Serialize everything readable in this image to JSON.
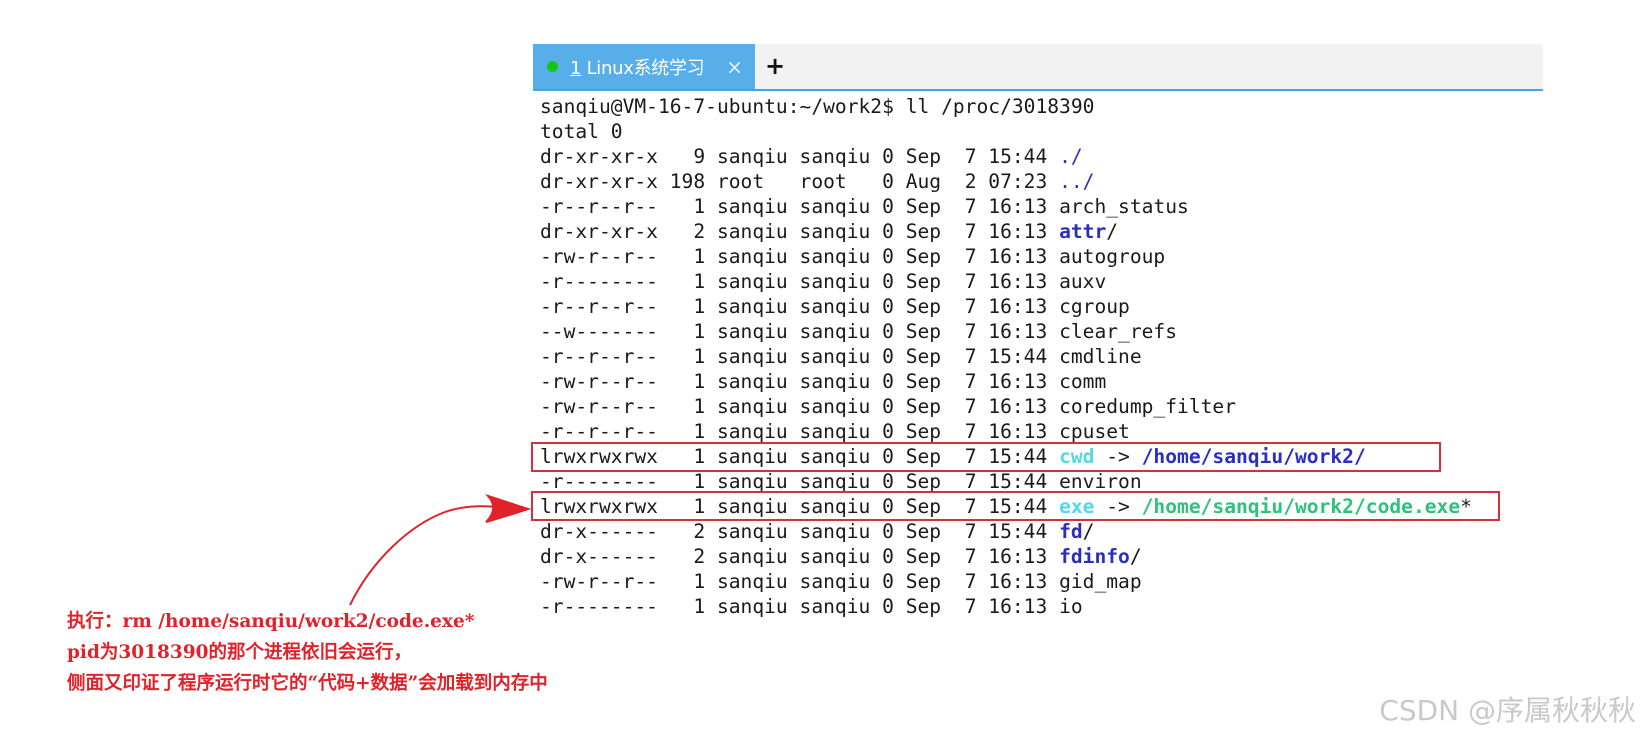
{
  "tab": {
    "number": "1",
    "title": "Linux系统学习",
    "close_icon": "×",
    "new_tab_icon": "+"
  },
  "terminal": {
    "prompt": "sanqiu@VM-16-7-ubuntu:~/work2$",
    "command": "ll /proc/3018390",
    "total": "total 0",
    "rows": [
      {
        "perm": "dr-xr-xr-x",
        "links": "9",
        "owner": "sanqiu",
        "group": "sanqiu",
        "size": "0",
        "mon": "Sep",
        "day": "7",
        "time": "15:44",
        "name": ".",
        "suffix": "/",
        "kind": "dir"
      },
      {
        "perm": "dr-xr-xr-x",
        "links": "198",
        "owner": "root",
        "group": "root",
        "size": "0",
        "mon": "Aug",
        "day": "2",
        "time": "07:23",
        "name": "..",
        "suffix": "/",
        "kind": "dir"
      },
      {
        "perm": "-r--r--r--",
        "links": "1",
        "owner": "sanqiu",
        "group": "sanqiu",
        "size": "0",
        "mon": "Sep",
        "day": "7",
        "time": "16:13",
        "name": "arch_status",
        "suffix": "",
        "kind": "file"
      },
      {
        "perm": "dr-xr-xr-x",
        "links": "2",
        "owner": "sanqiu",
        "group": "sanqiu",
        "size": "0",
        "mon": "Sep",
        "day": "7",
        "time": "16:13",
        "name": "attr",
        "suffix": "/",
        "kind": "dir-b"
      },
      {
        "perm": "-rw-r--r--",
        "links": "1",
        "owner": "sanqiu",
        "group": "sanqiu",
        "size": "0",
        "mon": "Sep",
        "day": "7",
        "time": "16:13",
        "name": "autogroup",
        "suffix": "",
        "kind": "file"
      },
      {
        "perm": "-r--------",
        "links": "1",
        "owner": "sanqiu",
        "group": "sanqiu",
        "size": "0",
        "mon": "Sep",
        "day": "7",
        "time": "16:13",
        "name": "auxv",
        "suffix": "",
        "kind": "file"
      },
      {
        "perm": "-r--r--r--",
        "links": "1",
        "owner": "sanqiu",
        "group": "sanqiu",
        "size": "0",
        "mon": "Sep",
        "day": "7",
        "time": "16:13",
        "name": "cgroup",
        "suffix": "",
        "kind": "file"
      },
      {
        "perm": "--w-------",
        "links": "1",
        "owner": "sanqiu",
        "group": "sanqiu",
        "size": "0",
        "mon": "Sep",
        "day": "7",
        "time": "16:13",
        "name": "clear_refs",
        "suffix": "",
        "kind": "file"
      },
      {
        "perm": "-r--r--r--",
        "links": "1",
        "owner": "sanqiu",
        "group": "sanqiu",
        "size": "0",
        "mon": "Sep",
        "day": "7",
        "time": "15:44",
        "name": "cmdline",
        "suffix": "",
        "kind": "file"
      },
      {
        "perm": "-rw-r--r--",
        "links": "1",
        "owner": "sanqiu",
        "group": "sanqiu",
        "size": "0",
        "mon": "Sep",
        "day": "7",
        "time": "16:13",
        "name": "comm",
        "suffix": "",
        "kind": "file"
      },
      {
        "perm": "-rw-r--r--",
        "links": "1",
        "owner": "sanqiu",
        "group": "sanqiu",
        "size": "0",
        "mon": "Sep",
        "day": "7",
        "time": "16:13",
        "name": "coredump_filter",
        "suffix": "",
        "kind": "file"
      },
      {
        "perm": "-r--r--r--",
        "links": "1",
        "owner": "sanqiu",
        "group": "sanqiu",
        "size": "0",
        "mon": "Sep",
        "day": "7",
        "time": "16:13",
        "name": "cpuset",
        "suffix": "",
        "kind": "file"
      },
      {
        "perm": "lrwxrwxrwx",
        "links": "1",
        "owner": "sanqiu",
        "group": "sanqiu",
        "size": "0",
        "mon": "Sep",
        "day": "7",
        "time": "15:44",
        "name": "cwd",
        "arrow": " -> ",
        "target": "/home/sanqiu/work2/",
        "suffix": "",
        "kind": "link-dir"
      },
      {
        "perm": "-r--------",
        "links": "1",
        "owner": "sanqiu",
        "group": "sanqiu",
        "size": "0",
        "mon": "Sep",
        "day": "7",
        "time": "15:44",
        "name": "environ",
        "suffix": "",
        "kind": "file"
      },
      {
        "perm": "lrwxrwxrwx",
        "links": "1",
        "owner": "sanqiu",
        "group": "sanqiu",
        "size": "0",
        "mon": "Sep",
        "day": "7",
        "time": "15:44",
        "name": "exe",
        "arrow": " -> ",
        "target": "/home/sanqiu/work2/code.exe",
        "suffix": "*",
        "kind": "link-exe"
      },
      {
        "perm": "dr-x------",
        "links": "2",
        "owner": "sanqiu",
        "group": "sanqiu",
        "size": "0",
        "mon": "Sep",
        "day": "7",
        "time": "15:44",
        "name": "fd",
        "suffix": "/",
        "kind": "dir-b"
      },
      {
        "perm": "dr-x------",
        "links": "2",
        "owner": "sanqiu",
        "group": "sanqiu",
        "size": "0",
        "mon": "Sep",
        "day": "7",
        "time": "16:13",
        "name": "fdinfo",
        "suffix": "/",
        "kind": "dir-b"
      },
      {
        "perm": "-rw-r--r--",
        "links": "1",
        "owner": "sanqiu",
        "group": "sanqiu",
        "size": "0",
        "mon": "Sep",
        "day": "7",
        "time": "16:13",
        "name": "gid_map",
        "suffix": "",
        "kind": "file"
      },
      {
        "perm": "-r--------",
        "links": "1",
        "owner": "sanqiu",
        "group": "sanqiu",
        "size": "0",
        "mon": "Sep",
        "day": "7",
        "time": "16:13",
        "name": "io",
        "suffix": "",
        "kind": "file"
      }
    ]
  },
  "annotation": {
    "line1": "执行：rm /home/sanqiu/work2/code.exe*",
    "line2": "pid为3018390的那个进程依旧会运行，",
    "line3": "侧面又印证了程序运行时它的“代码+数据”会加载到内存中"
  },
  "watermark": "CSDN @序属秋秋秋",
  "colors": {
    "tab_bg": "#58aee8",
    "status_dot": "#12c712",
    "highlight": "#d0343a",
    "annotation": "#e0232a",
    "dir": "#2a2fbf",
    "link": "#55d8e8",
    "exe": "#2ec27e"
  }
}
